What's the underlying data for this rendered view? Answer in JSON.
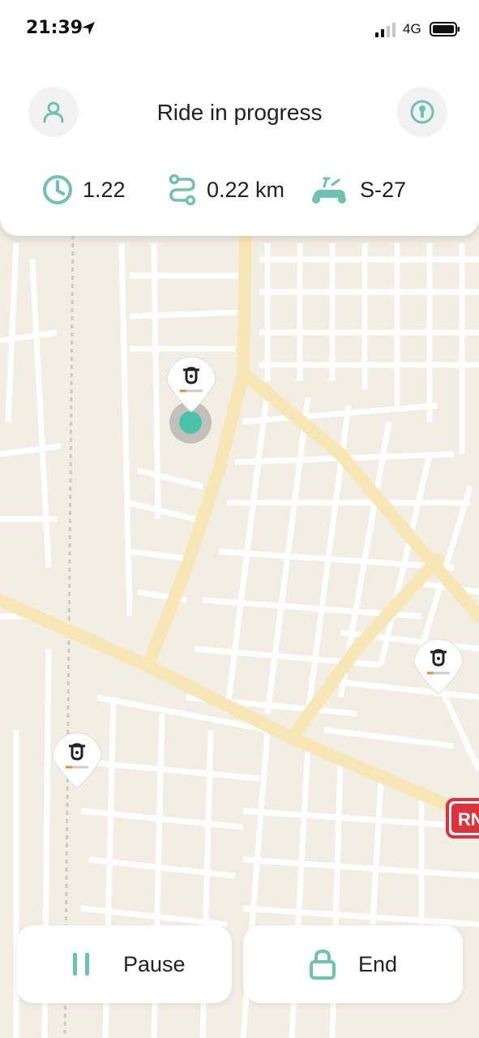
{
  "status_bar": {
    "time": "21:39",
    "network": "4G"
  },
  "header": {
    "title": "Ride in progress"
  },
  "stats": {
    "time": "1.22",
    "distance": "0.22 km",
    "scooter_id": "S-27"
  },
  "map": {
    "road_label": "RN"
  },
  "actions": {
    "pause_label": "Pause",
    "end_label": "End"
  },
  "colors": {
    "accent": "#6cc3b0",
    "map_bg": "#f3eee4",
    "major_road": "#f8e7b6",
    "road_badge": "#e0303a"
  },
  "icons": [
    "profile-icon",
    "key-icon",
    "clock-icon",
    "route-icon",
    "scooter-icon",
    "pause-icon",
    "lock-icon",
    "location-arrow-icon"
  ]
}
